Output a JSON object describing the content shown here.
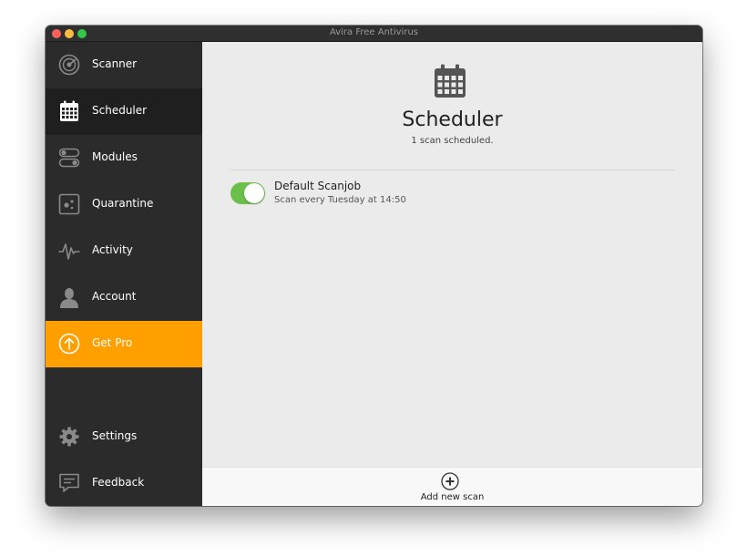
{
  "window": {
    "title": "Avira Free Antivirus"
  },
  "sidebar": {
    "items": [
      {
        "label": "Scanner",
        "icon": "radar-icon"
      },
      {
        "label": "Scheduler",
        "icon": "calendar-icon",
        "active": true
      },
      {
        "label": "Modules",
        "icon": "toggles-icon"
      },
      {
        "label": "Quarantine",
        "icon": "quarantine-icon"
      },
      {
        "label": "Activity",
        "icon": "pulse-icon"
      },
      {
        "label": "Account",
        "icon": "user-icon"
      },
      {
        "label": "Get Pro",
        "icon": "arrow-up-circle-icon",
        "highlight": true
      }
    ],
    "bottom_items": [
      {
        "label": "Settings",
        "icon": "gear-icon"
      },
      {
        "label": "Feedback",
        "icon": "feedback-icon"
      }
    ]
  },
  "main": {
    "title": "Scheduler",
    "subtitle": "1 scan scheduled.",
    "jobs": [
      {
        "name": "Default Scanjob",
        "description": "Scan every Tuesday at 14:50",
        "enabled": true
      }
    ],
    "footer": {
      "add_label": "Add new scan",
      "add_icon": "plus-circle-icon"
    }
  },
  "colors": {
    "sidebar_bg": "#2b2b2b",
    "sidebar_active": "#1f1f1f",
    "accent_orange": "#ff9f00",
    "toggle_on": "#6dbf4b",
    "content_bg": "#ebebeb"
  }
}
